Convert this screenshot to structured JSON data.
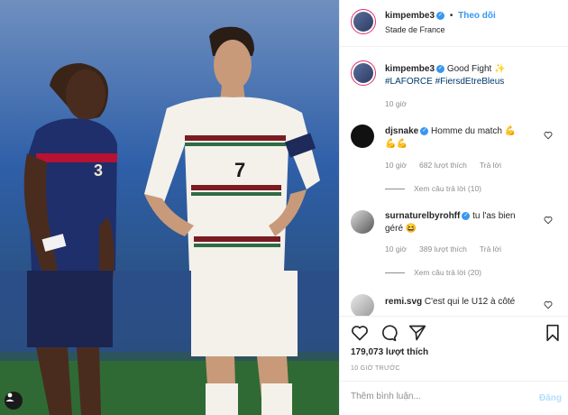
{
  "post": {
    "username": "kimpembe3",
    "follow_label": "Theo dõi",
    "location": "Stade de France",
    "caption_text": "Good Fight ✨",
    "caption_tags": "#LAFORCE #FiersdEtreBleus",
    "caption_time": "10 giờ"
  },
  "comments": [
    {
      "username": "djsnake",
      "text": "Homme du match 💪",
      "text2": "💪💪",
      "time": "10 giờ",
      "likes": "682 lượt thích",
      "reply": "Trả lời",
      "view_replies": "Xem câu trả lời (10)"
    },
    {
      "username": "surnaturelbyrohff",
      "text": "tu l'as bien",
      "text2": "géré 😆",
      "time": "10 giờ",
      "likes": "389 lượt thích",
      "reply": "Trả lời",
      "view_replies": "Xem câu trả lời (20)"
    },
    {
      "username": "remi.svg",
      "text": "C'est qui le U12 à côté"
    }
  ],
  "stats": {
    "likes": "179,073 lượt thích",
    "ago": "10 GIỜ TRƯỚC"
  },
  "comment_box": {
    "placeholder": "Thêm bình luận...",
    "post_label": "Đăng"
  },
  "photo": {
    "jersey_left": "3",
    "jersey_right": "7"
  },
  "colors": {
    "link": "#3897f0",
    "muted": "#8e8e8e",
    "like_red": "#ed4956"
  }
}
